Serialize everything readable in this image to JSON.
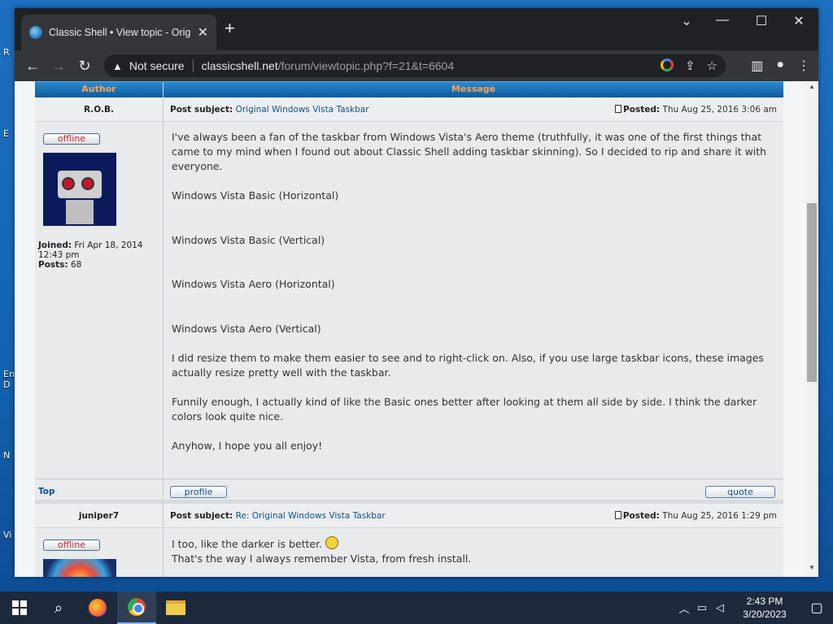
{
  "browser": {
    "tab_title": "Classic Shell • View topic - Origin",
    "not_secure": "Not secure",
    "url_host": "classicshell.net",
    "url_path": "/forum/viewtopic.php?f=21&t=6604"
  },
  "desktop": {
    "labels": [
      "R",
      "E",
      "",
      "",
      "",
      "",
      "En D",
      "",
      "N",
      "Vi"
    ]
  },
  "forum": {
    "header_author": "Author",
    "header_message": "Message",
    "posts": [
      {
        "author": "R.O.B.",
        "subject_label": "Post subject:",
        "subject": "Original Windows Vista Taskbar",
        "posted_label": "Posted:",
        "posted": "Thu Aug 25, 2016 3:06 am",
        "status": "offline",
        "joined_label": "Joined:",
        "joined": "Fri Apr 18, 2014 12:43 pm",
        "posts_label": "Posts:",
        "posts": "68",
        "body": [
          "I've always been a fan of the taskbar from Windows Vista's Aero theme (truthfully, it was one of the first things that came to my mind when I found out about Classic Shell adding taskbar skinning). So I decided to rip and share it with everyone.",
          "Windows Vista Basic (Horizontal)",
          "Windows Vista Basic (Vertical)",
          "Windows Vista Aero (Horizontal)",
          "Windows Vista Aero (Vertical)",
          "I did resize them to make them easier to see and to right-click on. Also, if you use large taskbar icons, these images actually resize pretty well with the taskbar.",
          "Funnily enough, I actually kind of like the Basic ones better after looking at them all side by side. I think the darker colors look quite nice.",
          "Anyhow, I hope you all enjoy!"
        ],
        "top_link": "Top",
        "profile_btn": "profile",
        "quote_btn": "quote"
      },
      {
        "author": "juniper7",
        "subject_label": "Post subject:",
        "subject": "Re: Original Windows Vista Taskbar",
        "posted_label": "Posted:",
        "posted": "Thu Aug 25, 2016 1:29 pm",
        "status": "offline",
        "body": [
          "I too, like the darker is better.",
          "That's the way I always remember Vista, from fresh install."
        ]
      }
    ]
  },
  "taskbar": {
    "time": "2:43 PM",
    "date": "3/20/2023"
  }
}
